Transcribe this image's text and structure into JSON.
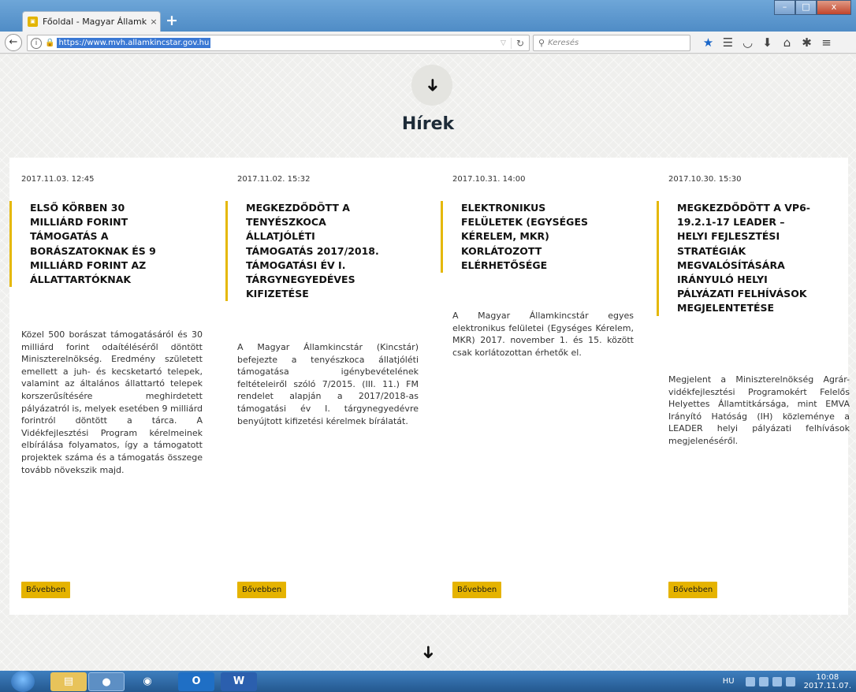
{
  "browser": {
    "tab_title": "Főoldal - Magyar Államkincst",
    "tab_close": "×",
    "new_tab": "+",
    "url": "https://www.mvh.allamkincstar.gov.hu",
    "search_placeholder": "Keresés",
    "window_controls": {
      "minimize": "–",
      "maximize": "□",
      "close": "x"
    }
  },
  "page": {
    "top_arrow": "➜",
    "section_title": "Hírek",
    "bottom_arrow": "➜",
    "more_label": "Bővebben",
    "news": [
      {
        "date": "2017.11.03. 12:45",
        "title": "ELSŐ KÖRBEN 30 MILLIÁRD FORINT TÁMOGATÁS A BORÁSZATOKNAK ÉS 9 MILLIÁRD FORINT AZ ÁLLATTARTÓKNAK",
        "body": "Közel 500 borászat támogatásáról és 30 milliárd forint odaítéléséről döntött Miniszterelnökség. Eredmény született emellett a juh- és kecsketartó telepek, valamint az általános állattartó telepek korszerűsítésére meghirdetett pályázatról is, melyek esetében 9 milliárd forintról döntött a tárca. A Vidékfejlesztési Program kérelmeinek elbírálása folyamatos, így a támogatott projektek száma és a támogatás összege tovább növekszik majd."
      },
      {
        "date": "2017.11.02. 15:32",
        "title": "MEGKEZDŐDÖTT A TENYÉSZKOCA ÁLLATJÓLÉTI TÁMOGATÁS 2017/2018. TÁMOGATÁSI ÉV I. TÁRGYNEGYEDÉVES KIFIZETÉSE",
        "body": "A Magyar Államkincstár (Kincstár) befejezte a tenyészkoca állatjóléti támogatása igénybevételének feltételeiről szóló 7/2015. (III. 11.) FM rendelet alapján a 2017/2018-as támogatási év I. tárgynegyedévre benyújtott kifizetési kérelmek bírálatát."
      },
      {
        "date": "2017.10.31. 14:00",
        "title": "ELEKTRONIKUS FELÜLETEK (EGYSÉGES KÉRELEM, MKR) KORLÁTOZOTT ELÉRHETŐSÉGE",
        "body": "A Magyar Államkincstár egyes elektronikus felületei (Egységes Kérelem, MKR) 2017. november 1. és 15. között csak korlátozottan érhetők el."
      },
      {
        "date": "2017.10.30. 15:30",
        "title": "MEGKEZDŐDÖTT A VP6-19.2.1-17 LEADER – HELYI FEJLESZTÉSI STRATÉGIÁK MEGVALÓSÍTÁSÁRA IRÁNYULÓ HELYI PÁLYÁZATI FELHÍVÁSOK MEGJELENTETÉSE",
        "body": "Megjelent a Miniszterelnökség Agrár-vidékfejlesztési Programokért Felelős Helyettes Államtitkársága, mint EMVA Irányító Hatóság (IH) közleménye a LEADER helyi pályázati felhívások megjelenéséről."
      }
    ]
  },
  "taskbar": {
    "language": "HU",
    "time": "10:08",
    "date": "2017.11.07."
  }
}
